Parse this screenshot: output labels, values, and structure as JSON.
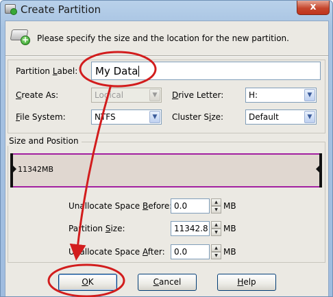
{
  "window": {
    "title": "Create Partition",
    "close_label": "x"
  },
  "header": {
    "icon": "disk-add-icon",
    "instruction": "Please specify the size and the location for the new partition."
  },
  "form": {
    "partition_label": {
      "prefix": "Partition ",
      "mnemonic": "L",
      "suffix": "abel:",
      "value": "My Data"
    },
    "create_as": {
      "mnemonic": "C",
      "suffix": "reate As:",
      "value": "Logical",
      "disabled": true
    },
    "drive_letter": {
      "mnemonic": "D",
      "suffix": "rive Letter:",
      "value": "H:"
    },
    "file_system": {
      "mnemonic": "F",
      "suffix": "ile System:",
      "value": "NTFS"
    },
    "cluster_size": {
      "prefix": "Cluster S",
      "mnemonic": "i",
      "suffix": "ze:",
      "value": "Default"
    }
  },
  "size_position": {
    "title": "Size and Position",
    "partition_size_text": "11342MB",
    "unallocate_before": {
      "prefix": "Unallocate Space ",
      "mnemonic": "B",
      "suffix": "efore:",
      "value": "0.0",
      "unit": "MB"
    },
    "partition_size": {
      "prefix": "Partition ",
      "mnemonic": "S",
      "suffix": "ize:",
      "value": "11342.8",
      "unit": "MB"
    },
    "unallocate_after": {
      "prefix": "Unallocate Space ",
      "mnemonic": "A",
      "suffix": "fter:",
      "value": "0.0",
      "unit": "MB"
    }
  },
  "buttons": {
    "ok": {
      "mnemonic": "O",
      "suffix": "K"
    },
    "cancel": {
      "mnemonic": "C",
      "suffix": "ancel"
    },
    "help": {
      "mnemonic": "H",
      "suffix": "elp"
    }
  },
  "annotation": {
    "color": "#d21d1d"
  }
}
